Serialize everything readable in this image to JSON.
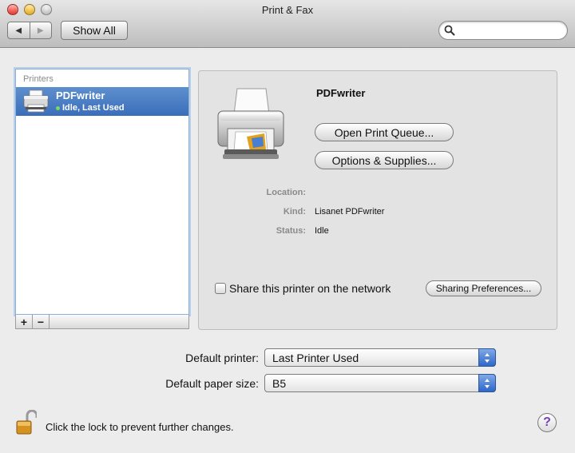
{
  "window": {
    "title": "Print & Fax",
    "show_all_label": "Show All",
    "search_placeholder": "",
    "back_glyph": "◀",
    "forward_glyph": "▶"
  },
  "printers_list": {
    "header": "Printers",
    "items": [
      {
        "name": "PDFwriter",
        "status": "Idle, Last Used",
        "status_color": "#7ed957"
      }
    ],
    "add_label": "+",
    "remove_label": "−"
  },
  "details": {
    "printer_name": "PDFwriter",
    "open_queue_label": "Open Print Queue...",
    "options_label": "Options & Supplies...",
    "location_label": "Location:",
    "location_value": "",
    "kind_label": "Kind:",
    "kind_value": "Lisanet PDFwriter",
    "status_label": "Status:",
    "status_value": "Idle",
    "share_label": "Share this printer on the network",
    "share_checked": false,
    "sharing_prefs_label": "Sharing Preferences..."
  },
  "defaults": {
    "printer_label": "Default printer:",
    "printer_value": "Last Printer Used",
    "paper_label": "Default paper size:",
    "paper_value": "B5"
  },
  "footer": {
    "lock_text": "Click the lock to prevent further changes.",
    "help_glyph": "?"
  },
  "colors": {
    "selection": "#3a6eb9",
    "popup_arrows": "#2f66c8",
    "help_icon": "#7a3fb4"
  },
  "icons": {
    "search": "magnifier-icon",
    "printer": "printer-icon",
    "lock": "unlocked-padlock-icon",
    "help": "help-icon"
  }
}
